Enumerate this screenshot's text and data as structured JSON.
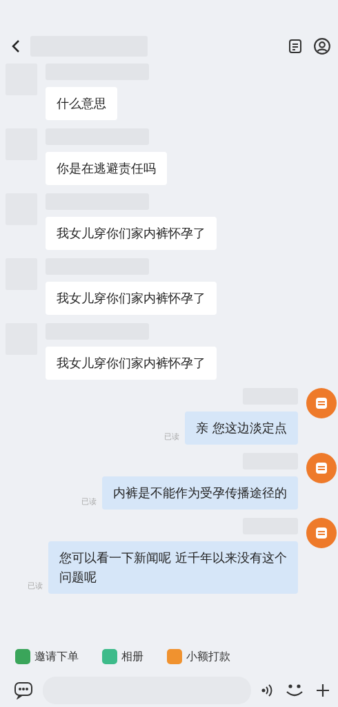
{
  "messages": [
    {
      "kind": "incoming",
      "text": "什么意思"
    },
    {
      "kind": "incoming",
      "text": "你是在逃避责任吗"
    },
    {
      "kind": "incoming",
      "text": "我女儿穿你们家内裤怀孕了"
    },
    {
      "kind": "incoming",
      "text": "我女儿穿你们家内裤怀孕了"
    },
    {
      "kind": "incoming",
      "text": "我女儿穿你们家内裤怀孕了"
    },
    {
      "kind": "outgoing",
      "text": "亲 您这边淡定点",
      "receipt": "已读"
    },
    {
      "kind": "outgoing",
      "text": "内裤是不能作为受孕传播途径的",
      "receipt": "已读"
    },
    {
      "kind": "outgoing",
      "text": "您可以看一下新闻呢 近千年以来没有这个问题呢",
      "receipt": "已读"
    }
  ],
  "quick_actions": [
    {
      "label": "邀请下单",
      "color": "#3aa55a"
    },
    {
      "label": "相册",
      "color": "#3dbb8a"
    },
    {
      "label": "小额打款",
      "color": "#f0922f"
    }
  ]
}
